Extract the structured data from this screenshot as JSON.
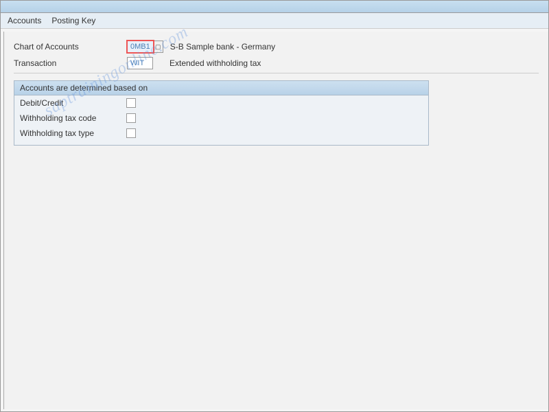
{
  "menu": {
    "accounts": "Accounts",
    "postingKey": "Posting Key"
  },
  "fields": {
    "chartOfAccounts": {
      "label": "Chart of Accounts",
      "value": "0MB1",
      "description": "S-B Sample bank - Germany"
    },
    "transaction": {
      "label": "Transaction",
      "value": "WIT",
      "description": "Extended withholding tax"
    }
  },
  "groupBox": {
    "title": "Accounts are determined based on",
    "rows": [
      {
        "label": "Debit/Credit"
      },
      {
        "label": "Withholding tax code"
      },
      {
        "label": "Withholding tax type"
      }
    ]
  },
  "watermark": "saptrainingonline.com"
}
